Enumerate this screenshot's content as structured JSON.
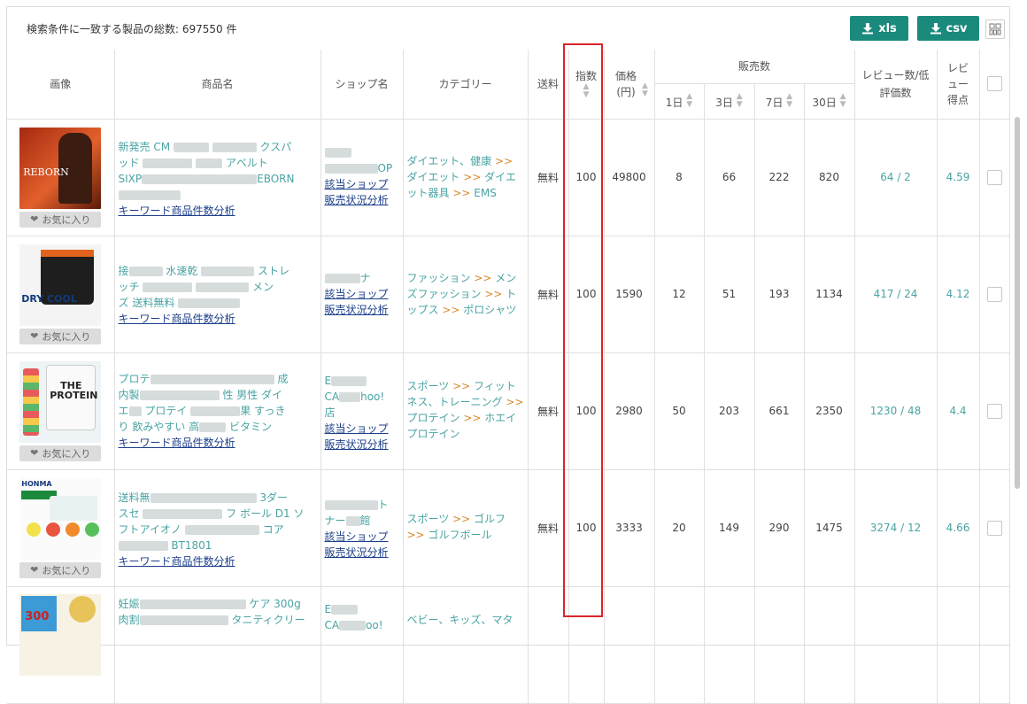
{
  "header": {
    "total_label": "検索条件に一致する製品の総数: 697550 件",
    "xls_label": "xls",
    "csv_label": "csv"
  },
  "columns": {
    "image": "画像",
    "product_name": "商品名",
    "shop_name": "ショップ名",
    "category": "カテゴリー",
    "shipping": "送料",
    "index": "指数",
    "price": "価格(円)",
    "sales": "販売数",
    "day1": "1日",
    "day3": "3日",
    "day7": "7日",
    "day30": "30日",
    "reviews": "レビュー数/低評価数",
    "review_score": "レビュー得点"
  },
  "common": {
    "favorite": "お気に入り",
    "keyword_analysis": "キーワード商品件数分析",
    "shop_link": "該当ショップ",
    "sales_analysis": "販売状況分析"
  },
  "rows": [
    {
      "img_text": "REBORN",
      "name_parts": [
        "新発売 CM",
        "クスパ",
        "ッド",
        "アベルト",
        "SIXP",
        "EBORN"
      ],
      "shop_parts": [
        "OP"
      ],
      "category": [
        "ダイエット、健康",
        "ダイエット",
        "ダイエット器具",
        "EMS"
      ],
      "shipping": "無料",
      "index": "100",
      "price": "49800",
      "d1": "8",
      "d3": "66",
      "d7": "222",
      "d30": "820",
      "reviews": "64",
      "low": "2",
      "score": "4.59"
    },
    {
      "img_text": "DRY COOL",
      "name_parts": [
        "接",
        "水速乾",
        "ストレ",
        "ッチ",
        "メン",
        "ズ 送料無料"
      ],
      "shop_parts": [
        "ナ"
      ],
      "category": [
        "ファッション",
        "メンズファッション",
        "トップス",
        "ポロシャツ"
      ],
      "shipping": "無料",
      "index": "100",
      "price": "1590",
      "d1": "12",
      "d3": "51",
      "d7": "193",
      "d30": "1134",
      "reviews": "417",
      "low": "24",
      "score": "4.12"
    },
    {
      "img_text": "THE PROTEIN",
      "name_parts": [
        "プロテ",
        "成",
        "内製",
        "性 男性 ダイ",
        "エ",
        "プロテイ",
        "果 すっき",
        "り 飲みやすい 高",
        "ビタミン"
      ],
      "shop_parts": [
        "E",
        "CA",
        "hoo!",
        "店"
      ],
      "category": [
        "スポーツ",
        "フィットネス、トレーニング",
        "プロテイン",
        "ホエイプロテイン"
      ],
      "shipping": "無料",
      "index": "100",
      "price": "2980",
      "d1": "50",
      "d3": "203",
      "d7": "661",
      "d30": "2350",
      "reviews": "1230",
      "low": "48",
      "score": "4.4"
    },
    {
      "img_text": "HONMA",
      "name_parts": [
        "送料無",
        "3ダー",
        "スセ",
        "フ ボール D1 ソ",
        "フトアイオノ",
        "コア",
        "BT1801"
      ],
      "shop_parts": [
        "ト",
        "ナー",
        "館"
      ],
      "category": [
        "スポーツ",
        "ゴルフ",
        "ゴルフボール"
      ],
      "shipping": "無料",
      "index": "100",
      "price": "3333",
      "d1": "20",
      "d3": "149",
      "d7": "290",
      "d30": "1475",
      "reviews": "3274",
      "low": "12",
      "score": "4.66"
    },
    {
      "img_text": "300",
      "name_parts": [
        "妊娠",
        "ケア 300g",
        "肉割",
        "タニティクリー"
      ],
      "shop_parts": [
        "E",
        "CA",
        "oo!"
      ],
      "category": [
        "ベビー、キッズ、マタ"
      ]
    }
  ],
  "colors": {
    "accent_button": "#1a8a7d",
    "link_teal": "#4aa3a3",
    "link_navy": "#1c3f8a",
    "category_separator": "#d98a2b",
    "highlight_box": "#d9262a"
  }
}
